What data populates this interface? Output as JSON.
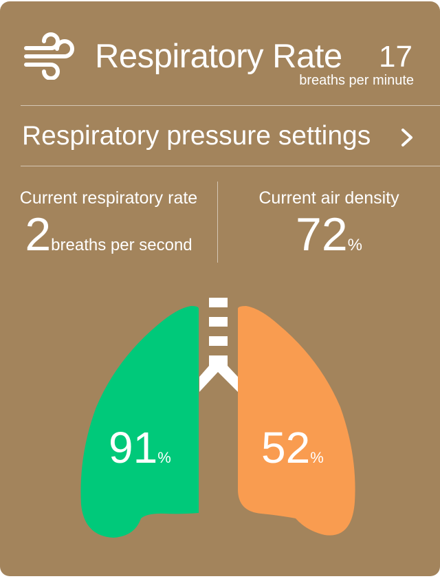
{
  "header": {
    "icon": "wind-icon",
    "title": "Respiratory Rate",
    "value": "17",
    "unit": "breaths per minute"
  },
  "settings": {
    "label": "Respiratory pressure settings",
    "icon": "chevron-right-icon"
  },
  "stats": {
    "respiratory_rate": {
      "label": "Current respiratory rate",
      "value": "2",
      "unit": "breaths per second"
    },
    "air_density": {
      "label": "Current air density",
      "value": "72",
      "unit": "%"
    }
  },
  "lungs": {
    "left": {
      "value": "91",
      "unit": "%",
      "color": "#00c97a"
    },
    "right": {
      "value": "52",
      "unit": "%",
      "color": "#f99c50"
    }
  },
  "colors": {
    "background": "#a3845c",
    "text": "#ffffff"
  }
}
